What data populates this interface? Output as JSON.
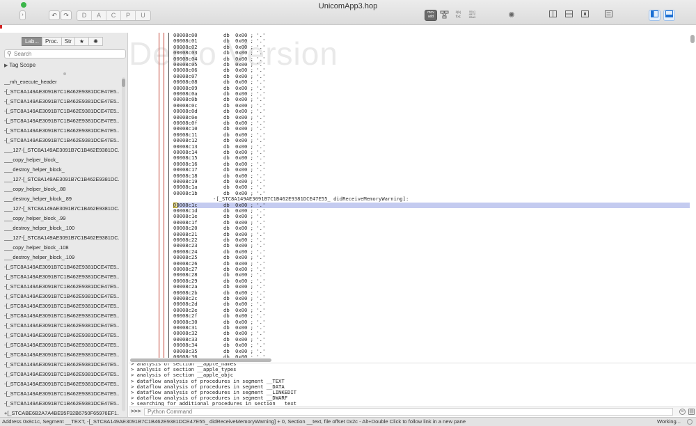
{
  "window": {
    "title": "UnicomApp3.hop"
  },
  "toolbar": {
    "nav_back": "↶",
    "nav_forward": "↷",
    "type_buttons": [
      "D",
      "A",
      "C",
      "P",
      "U"
    ],
    "mode_buttons": [
      {
        "label": "mov\nadd",
        "icon": "assembly-mode-icon"
      },
      {
        "label": "",
        "icon": "cfg-graph-icon"
      },
      {
        "label": "if(b)\nf(x);",
        "icon": "pseudocode-icon"
      },
      {
        "label": "00A1\n4B7C\n2BA9",
        "icon": "hex-view-icon"
      }
    ]
  },
  "sidebar": {
    "tabs": [
      {
        "label": "Lab...",
        "active": true
      },
      {
        "label": "Proc.",
        "active": false
      },
      {
        "label": "Str",
        "active": false
      },
      {
        "label": "★",
        "active": false
      },
      {
        "label": "✺",
        "active": false
      }
    ],
    "search_placeholder": "Search",
    "tag_scope": "Tag Scope",
    "symbols": [
      "__mh_execute_header",
      "-[_STC8A149AE3091B7C1B462E9381DCE47E5...",
      "-[_STC8A149AE3091B7C1B462E9381DCE47E5...",
      "-[_STC8A149AE3091B7C1B462E9381DCE47E5...",
      "-[_STC8A149AE3091B7C1B462E9381DCE47E5...",
      "-[_STC8A149AE3091B7C1B462E9381DCE47E5...",
      "-[_STC8A149AE3091B7C1B462E9381DCE47E5...",
      "___127-[_STC8A149AE3091B7C1B462E9381DC...",
      "___copy_helper_block_",
      "___destroy_helper_block_",
      "___127-[_STC8A149AE3091B7C1B462E9381DC...",
      "___copy_helper_block_.88",
      "___destroy_helper_block_.89",
      "___127-[_STC8A149AE3091B7C1B462E9381DC...",
      "___copy_helper_block_.99",
      "___destroy_helper_block_.100",
      "___127-[_STC8A149AE3091B7C1B462E9381DC...",
      "___copy_helper_block_.108",
      "___destroy_helper_block_.109",
      "-[_STC8A149AE3091B7C1B462E9381DCE47E5...",
      "-[_STC8A149AE3091B7C1B462E9381DCE47E5...",
      "-[_STC8A149AE3091B7C1B462E9381DCE47E5...",
      "-[_STC8A149AE3091B7C1B462E9381DCE47E5...",
      "-[_STC8A149AE3091B7C1B462E9381DCE47E5...",
      "-[_STC8A149AE3091B7C1B462E9381DCE47E5...",
      "-[_STC8A149AE3091B7C1B462E9381DCE47E5...",
      "-[_STC8A149AE3091B7C1B462E9381DCE47E5...",
      "-[_STC8A149AE3091B7C1B462E9381DCE47E5...",
      "-[_STC8A149AE3091B7C1B462E9381DCE47E5...",
      "-[_STC8A149AE3091B7C1B462E9381DCE47E5...",
      "-[_STC8A149AE3091B7C1B462E9381DCE47E5...",
      "-[_STC8A149AE3091B7C1B462E9381DCE47E5...",
      "-[_STC8A149AE3091B7C1B462E9381DCE47E5...",
      "-[_STC8A149AE3091B7C1B462E9381DCE47E5...",
      "+[_STCABE6B2A7A4BE95F92B6750F65976EF1...",
      "-[_STCABE6B2A7A4BE95F92B6750F65976EF1..."
    ]
  },
  "disasm": {
    "watermark": "Demo Version",
    "pre_addresses": [
      "00008c00",
      "00008c01",
      "00008c02",
      "00008c03",
      "00008c04",
      "00008c05",
      "00008c06",
      "00008c07",
      "00008c08",
      "00008c09",
      "00008c0a",
      "00008c0b",
      "00008c0c",
      "00008c0d",
      "00008c0e",
      "00008c0f",
      "00008c10",
      "00008c11",
      "00008c12",
      "00008c13",
      "00008c14",
      "00008c15",
      "00008c16",
      "00008c17",
      "00008c18",
      "00008c19",
      "00008c1a",
      "00008c1b"
    ],
    "proc_label": "-[_STC8A149AE3091B7C1B462E9381DCE47E55_ didReceiveMemoryWarning]:",
    "post_addresses": [
      "00008c1c",
      "00008c1d",
      "00008c1e",
      "00008c1f",
      "00008c20",
      "00008c21",
      "00008c22",
      "00008c23",
      "00008c24",
      "00008c25",
      "00008c26",
      "00008c27",
      "00008c28",
      "00008c29",
      "00008c2a",
      "00008c2b",
      "00008c2c",
      "00008c2d",
      "00008c2e",
      "00008c2f",
      "00008c30",
      "00008c31",
      "00008c32",
      "00008c33",
      "00008c34",
      "00008c35",
      "00008c36"
    ],
    "mnemonic": "db",
    "operand": "0x00 ; '.'",
    "highlighted_address": "00008c1c"
  },
  "console": {
    "lines": [
      "> analysis of section __apple_types",
      "> analysis of section __apple_objc",
      "> dataflow analysis of procedures in segment __TEXT",
      "> dataflow analysis of procedures in segment __DATA",
      "> dataflow analysis of procedures in segment __LINKEDIT",
      "> dataflow analysis of procedures in segment __DWARF",
      "> searching for additional procedures in section __text"
    ],
    "prompt": ">>>",
    "input_placeholder": "Python Command"
  },
  "status": {
    "text": "Address 0x8c1c, Segment __TEXT, -[_STC8A149AE3091B7C1B462E9381DCE47E55_ didReceiveMemoryWarning] + 0, Section __text, file offset 0x2c - Alt+Double Click to follow link in a new pane",
    "right": "Working..."
  },
  "colors": {
    "highlight": "#c4cbf0",
    "gutter_red": "#c0392b",
    "toolbar_bg": "#e4e4e4",
    "accent_blue": "#1b6fd3"
  }
}
